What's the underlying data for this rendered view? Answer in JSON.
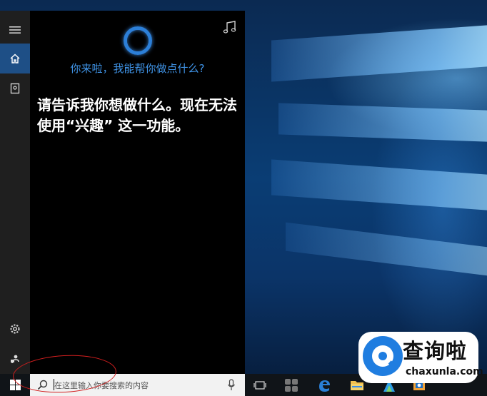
{
  "cortana": {
    "greeting": "你来啦，我能帮你做点什么?",
    "message": "请告诉我你想做什么。现在无法使用“兴趣” 这一功能。",
    "rail": {
      "menu_icon": "hamburger-menu-icon",
      "home_icon": "home-icon",
      "notebook_icon": "notebook-icon",
      "settings_icon": "gear-icon",
      "feedback_icon": "feedback-icon"
    },
    "music_icon": "music-note-icon",
    "accent_color": "#2c7fd8"
  },
  "taskbar": {
    "search_placeholder": "在这里输入你要搜索的内容",
    "icons": [
      "windows-start-icon",
      "search-icon",
      "microphone-icon",
      "task-view-icon",
      "app-icon",
      "edge-icon",
      "file-explorer-icon",
      "store-icon",
      "outlook-icon"
    ]
  },
  "watermark": {
    "brand_cn": "查询啦",
    "brand_en": "chaxunla.com"
  }
}
